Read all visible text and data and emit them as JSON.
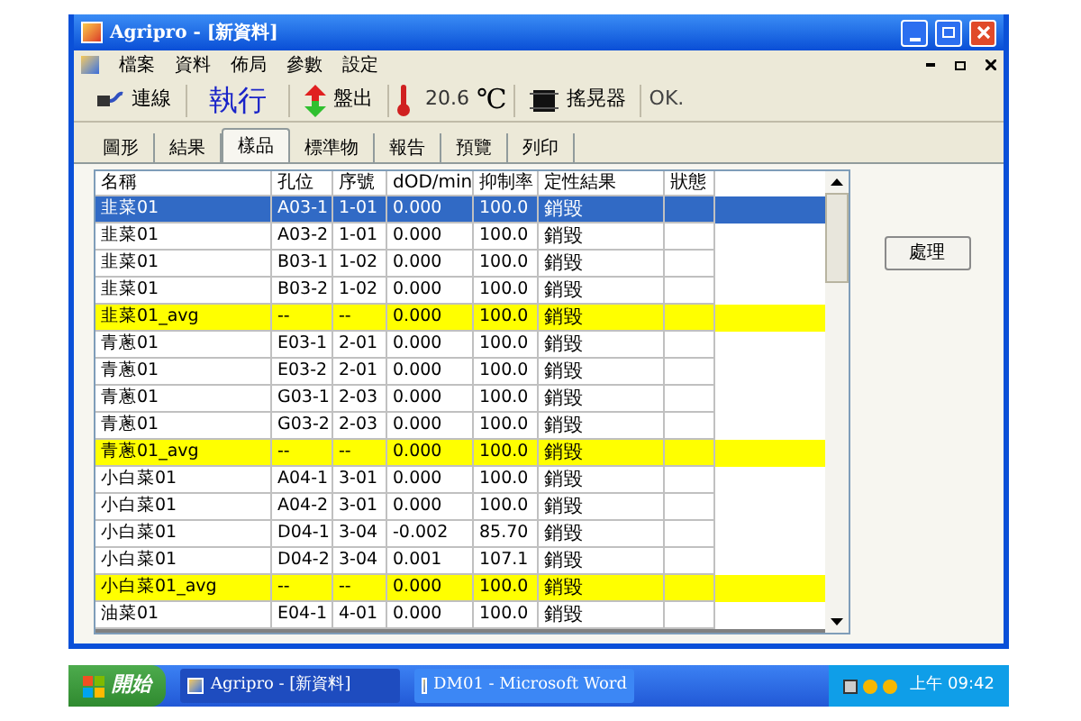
{
  "window": {
    "title": "Agripro - [新資料]"
  },
  "menu": [
    "檔案",
    "資料",
    "佈局",
    "參數",
    "設定"
  ],
  "toolbar": {
    "connect": "連線",
    "run": "執行",
    "plate_out": "盤出",
    "temperature": "20.6",
    "unit": "℃",
    "shaker": "搖晃器",
    "status": "OK."
  },
  "tabs": [
    {
      "label": "圖形",
      "selected": false
    },
    {
      "label": "結果",
      "selected": false
    },
    {
      "label": "樣品",
      "selected": true
    },
    {
      "label": "標準物",
      "selected": false
    },
    {
      "label": "報告",
      "selected": false
    },
    {
      "label": "預覽",
      "selected": false
    },
    {
      "label": "列印",
      "selected": false
    }
  ],
  "table": {
    "columns": [
      "名稱",
      "孔位",
      "序號",
      "dOD/min",
      "抑制率",
      "定性結果",
      "狀態"
    ],
    "rows": [
      {
        "kind": "sample",
        "selected": true,
        "cells": [
          "韭菜01",
          "A03-1",
          "1-01",
          "0.000",
          "100.0",
          "銷毀"
        ]
      },
      {
        "kind": "sample",
        "selected": false,
        "cells": [
          "韭菜01",
          "A03-2",
          "1-01",
          "0.000",
          "100.0",
          "銷毀"
        ]
      },
      {
        "kind": "sample",
        "selected": false,
        "cells": [
          "韭菜01",
          "B03-1",
          "1-02",
          "0.000",
          "100.0",
          "銷毀"
        ]
      },
      {
        "kind": "sample",
        "selected": false,
        "cells": [
          "韭菜01",
          "B03-2",
          "1-02",
          "0.000",
          "100.0",
          "銷毀"
        ]
      },
      {
        "kind": "avg",
        "selected": false,
        "cells": [
          "韭菜01_avg",
          "--",
          "--",
          "0.000",
          "100.0",
          "銷毀"
        ]
      },
      {
        "kind": "sample",
        "selected": false,
        "cells": [
          "青蔥01",
          "E03-1",
          "2-01",
          "0.000",
          "100.0",
          "銷毀"
        ]
      },
      {
        "kind": "sample",
        "selected": false,
        "cells": [
          "青蔥01",
          "E03-2",
          "2-01",
          "0.000",
          "100.0",
          "銷毀"
        ]
      },
      {
        "kind": "sample",
        "selected": false,
        "cells": [
          "青蔥01",
          "G03-1",
          "2-03",
          "0.000",
          "100.0",
          "銷毀"
        ]
      },
      {
        "kind": "sample",
        "selected": false,
        "cells": [
          "青蔥01",
          "G03-2",
          "2-03",
          "0.000",
          "100.0",
          "銷毀"
        ]
      },
      {
        "kind": "avg",
        "selected": false,
        "cells": [
          "青蔥01_avg",
          "--",
          "--",
          "0.000",
          "100.0",
          "銷毀"
        ]
      },
      {
        "kind": "sample",
        "selected": false,
        "cells": [
          "小白菜01",
          "A04-1",
          "3-01",
          "0.000",
          "100.0",
          "銷毀"
        ]
      },
      {
        "kind": "sample",
        "selected": false,
        "cells": [
          "小白菜01",
          "A04-2",
          "3-01",
          "0.000",
          "100.0",
          "銷毀"
        ]
      },
      {
        "kind": "sample",
        "selected": false,
        "cells": [
          "小白菜01",
          "D04-1",
          "3-04",
          "-0.002",
          "85.70",
          "銷毀"
        ]
      },
      {
        "kind": "sample",
        "selected": false,
        "cells": [
          "小白菜01",
          "D04-2",
          "3-04",
          "0.001",
          "107.1",
          "銷毀"
        ]
      },
      {
        "kind": "avg",
        "selected": false,
        "cells": [
          "小白菜01_avg",
          "--",
          "--",
          "0.000",
          "100.0",
          "銷毀"
        ]
      },
      {
        "kind": "sample",
        "selected": false,
        "cells": [
          "油菜01",
          "E04-1",
          "4-01",
          "0.000",
          "100.0",
          "銷毀"
        ]
      }
    ]
  },
  "process_button": "處理",
  "taskbar": {
    "start": "開始",
    "tasks": [
      {
        "label": "Agripro - [新資料]",
        "selected": true
      },
      {
        "label": "DM01 - Microsoft Word",
        "selected": false
      }
    ],
    "clock": "上午 09:42"
  }
}
